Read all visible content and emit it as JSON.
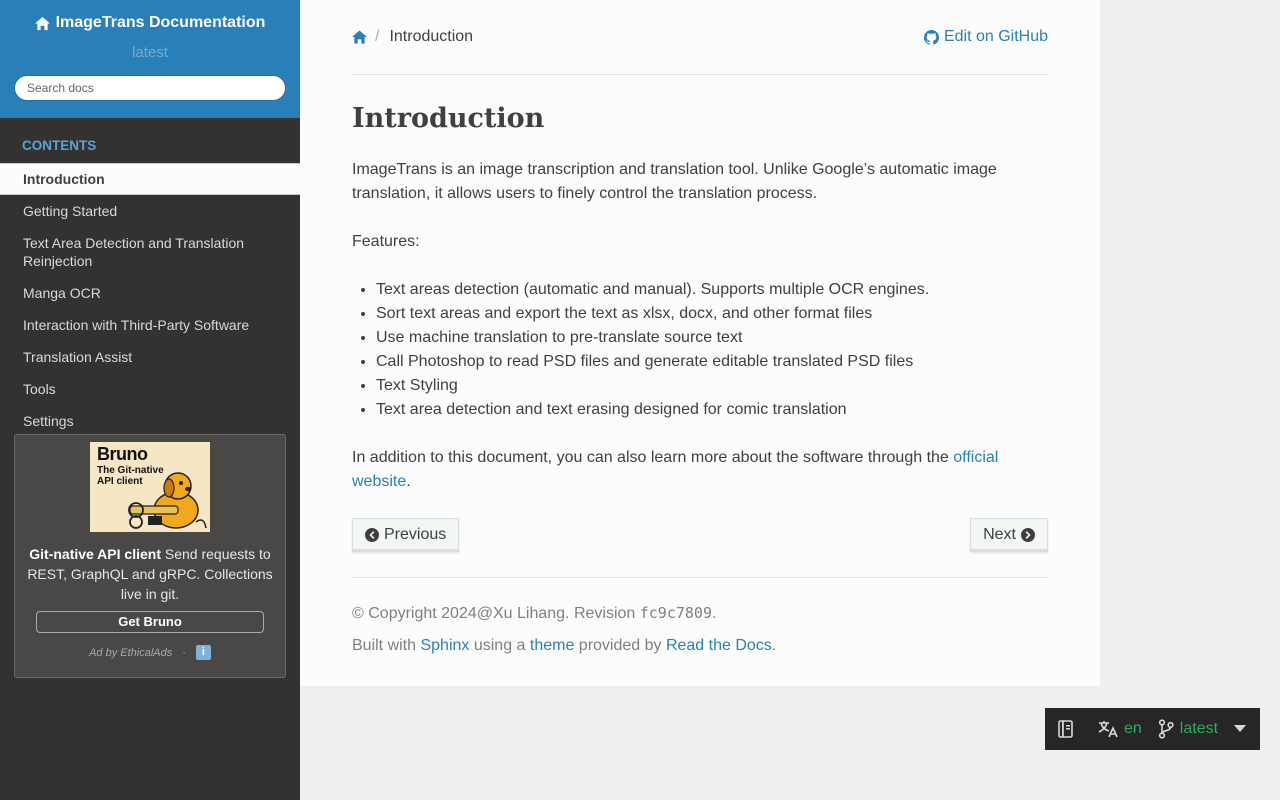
{
  "sidebar": {
    "project_title": "ImageTrans Documentation",
    "version": "latest",
    "search_placeholder": "Search docs",
    "caption": "CONTENTS",
    "items": [
      {
        "label": "Introduction",
        "current": true
      },
      {
        "label": "Getting Started"
      },
      {
        "label": "Text Area Detection and Translation Reinjection"
      },
      {
        "label": "Manga OCR"
      },
      {
        "label": "Interaction with Third-Party Software"
      },
      {
        "label": "Translation Assist"
      },
      {
        "label": "Tools"
      },
      {
        "label": "Settings"
      }
    ]
  },
  "ad": {
    "image_brand": "Bruno",
    "image_tagline": "The Git-native API client",
    "headline": "Git-native API client",
    "text": " Send requests to REST, GraphQL and gRPC. Collections live in git.",
    "cta": "Get Bruno",
    "by": "Ad by EthicalAds",
    "dot": "·",
    "info": "i"
  },
  "breadcrumb": {
    "current": "Introduction",
    "sep": "/",
    "edit_label": "Edit on GitHub"
  },
  "page": {
    "title": "Introduction",
    "intro": "ImageTrans is an image transcription and translation tool. Unlike Google’s automatic image translation, it allows users to finely control the translation process.",
    "features_label": "Features:",
    "features": [
      "Text areas detection (automatic and manual). Supports multiple OCR engines.",
      "Sort text areas and export the text as xlsx, docx, and other format files",
      "Use machine translation to pre-translate source text",
      "Call Photoshop to read PSD files and generate editable translated PSD files",
      "Text Styling",
      "Text area detection and text erasing designed for comic translation"
    ],
    "addition_text": "In addition to this document, you can also learn more about the software through the ",
    "addition_link": "official website",
    "addition_end": "."
  },
  "pager": {
    "previous": "Previous",
    "next": "Next"
  },
  "footer": {
    "copyright": "© Copyright 2024@Xu Lihang. Revision ",
    "revision": "fc9c7809",
    "copyright_end": ".",
    "built_with": "Built with ",
    "sphinx": "Sphinx",
    "using_a": " using a ",
    "theme": "theme",
    "provided_by": " provided by ",
    "rtd": "Read the Docs",
    "built_end": "."
  },
  "flyout": {
    "language": "en",
    "version": "latest"
  },
  "colors": {
    "accent": "#2980b9",
    "sidebar_bg": "#343131",
    "caption": "#55a5d9",
    "flyout_text": "#27ae60"
  }
}
